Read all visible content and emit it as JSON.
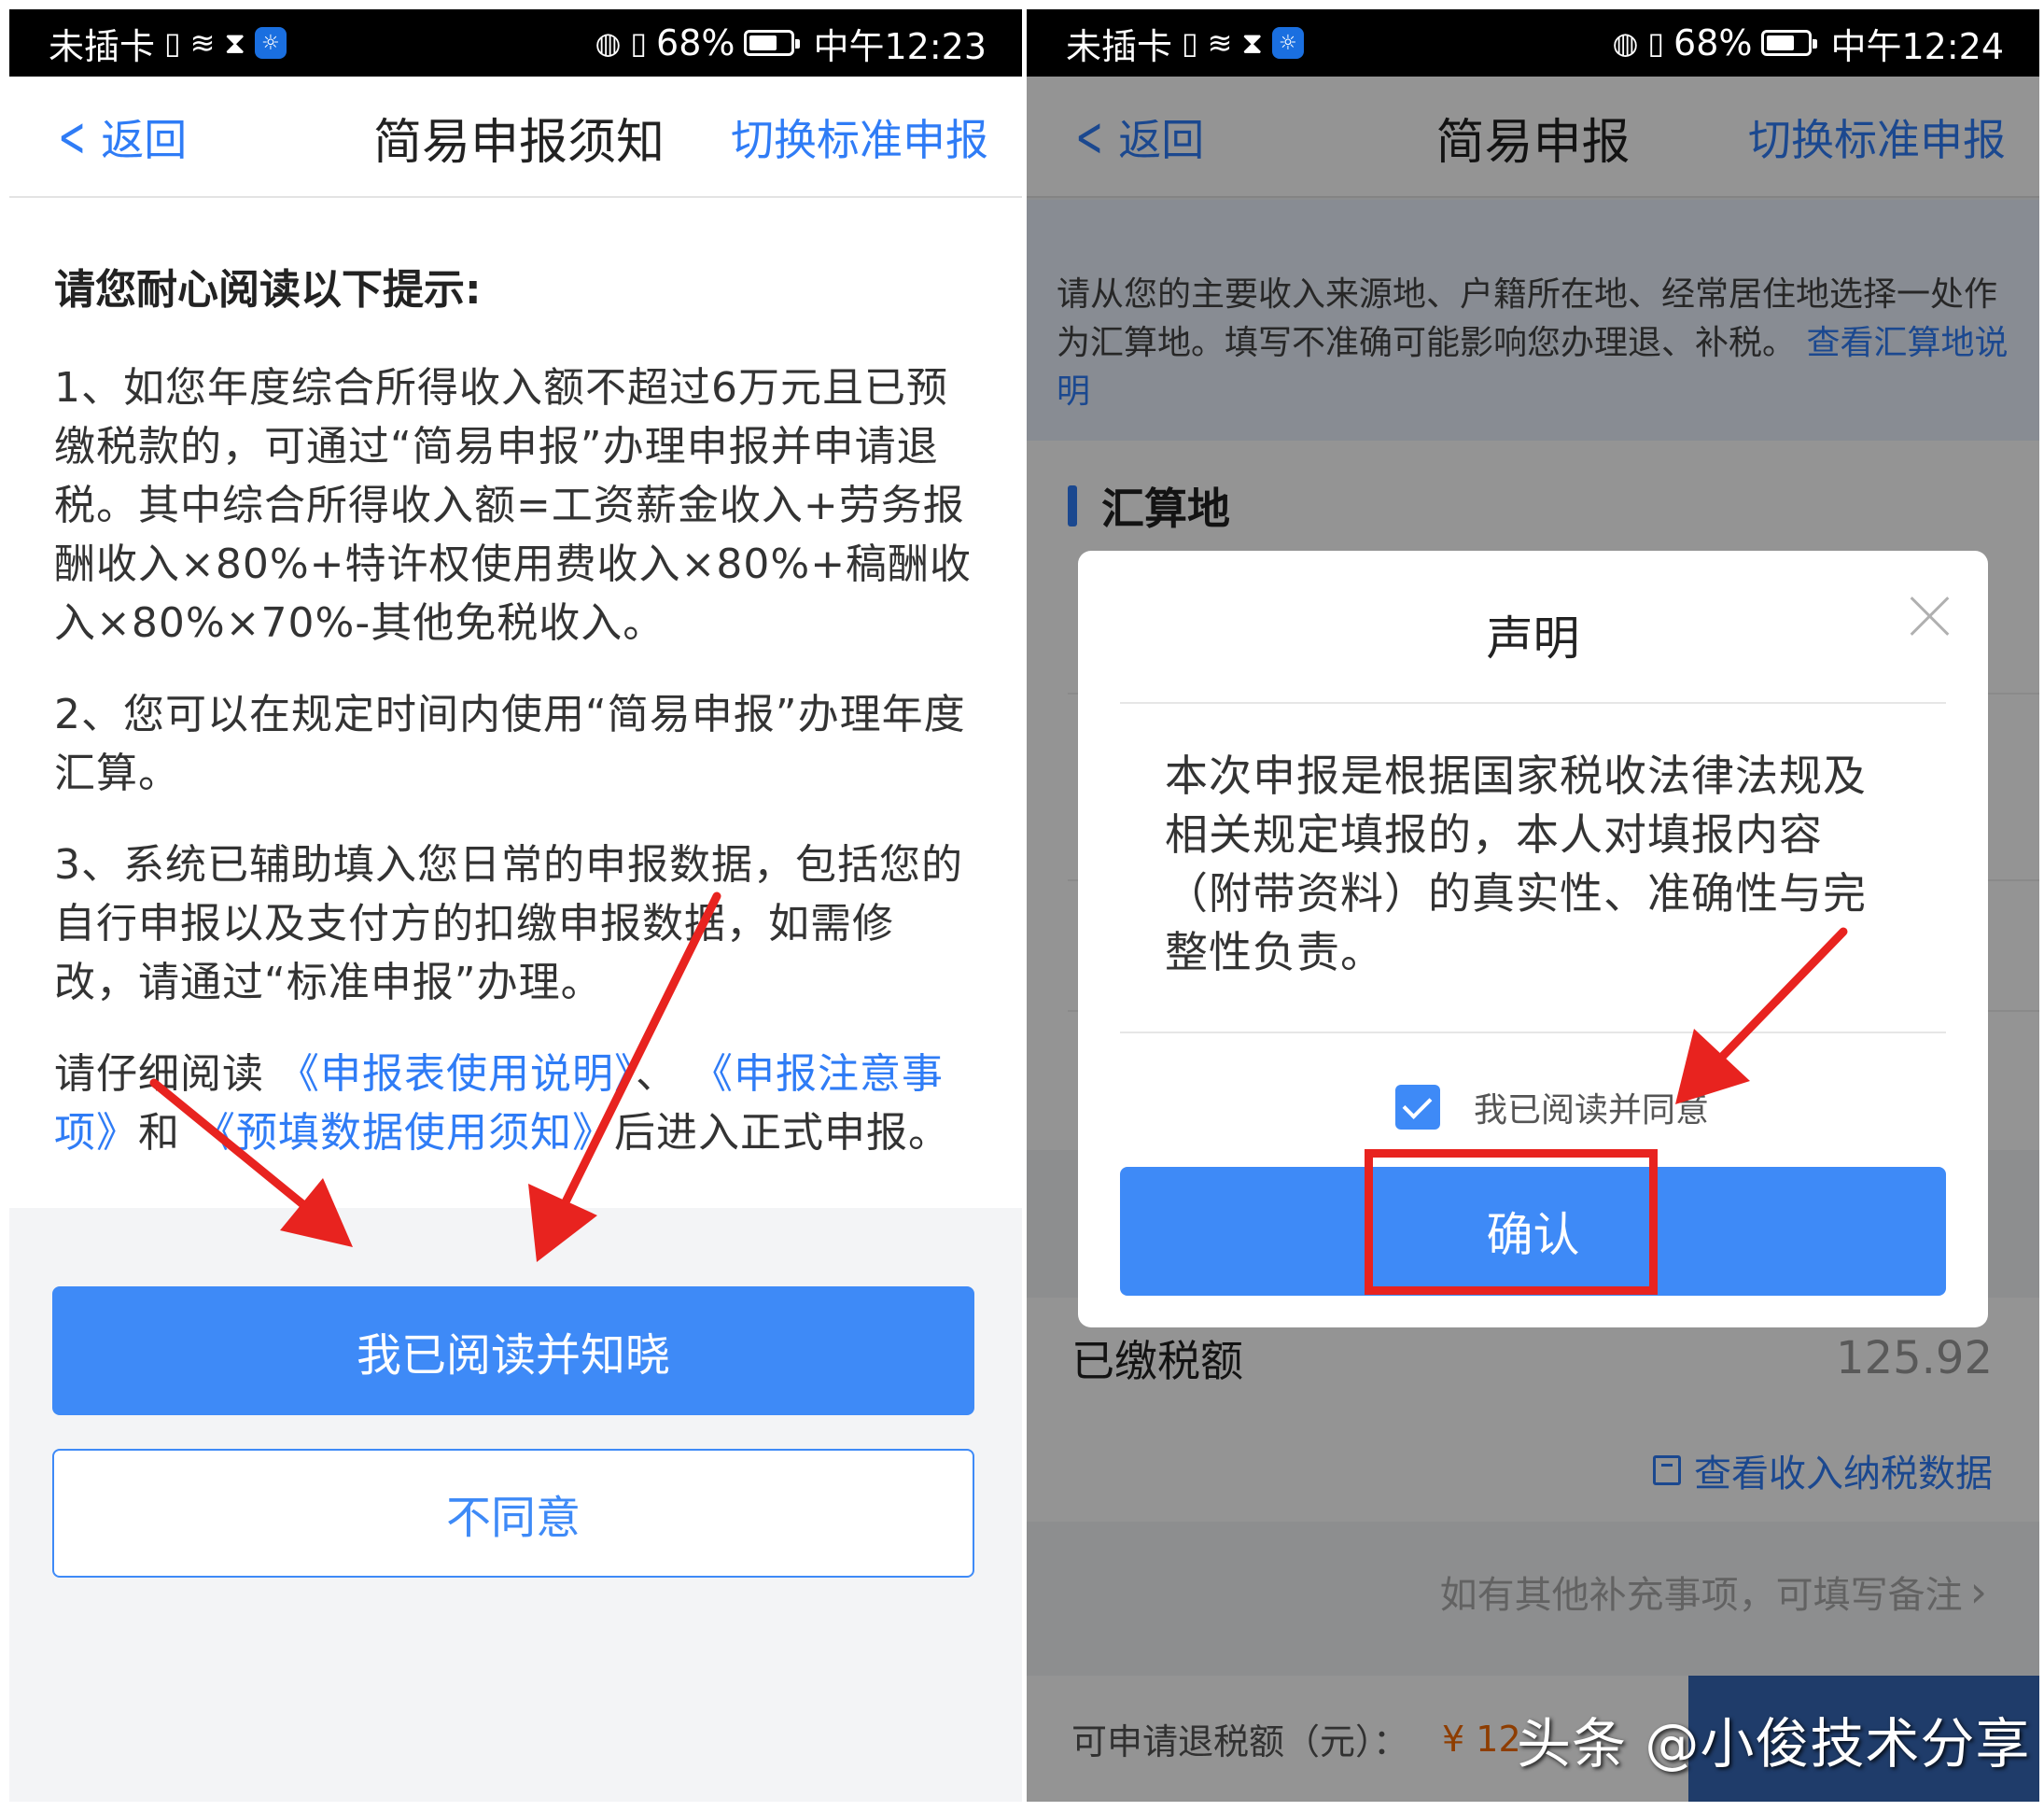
{
  "status_left": {
    "carrier": "未插卡",
    "time": "中午12:23",
    "battery": "68%"
  },
  "status_right": {
    "carrier": "未插卡",
    "time": "中午12:24",
    "battery": "68%"
  },
  "left_screen": {
    "nav": {
      "back": "返回",
      "title": "简易申报须知",
      "switch": "切换标准申报"
    },
    "heading": "请您耐心阅读以下提示:",
    "para1": "1、如您年度综合所得收入额不超过6万元且已预缴税款的，可通过“简易申报”办理申报并申请退税。其中综合所得收入额=工资薪金收入+劳务报酬收入×80%+特许权使用费收入×80%+稿酬收入×80%×70%-其他免税收入。",
    "para2": "2、您可以在规定时间内使用“简易申报”办理年度汇算。",
    "para3": "3、系统已辅助填入您日常的申报数据，包括您的自行申报以及支付方的扣缴申报数据，如需修改，请通过“标准申报”办理。",
    "para4": {
      "prefix": "请仔细阅读",
      "link1": "《申报表使用说明》",
      "sep": "、",
      "link2": "《申报注意事项》",
      "and": "和",
      "link3": "《预填数据使用须知》",
      "suffix": "后进入正式申报。"
    },
    "btn_acknowledge": "我已阅读并知晓",
    "btn_disagree": "不同意"
  },
  "right_screen": {
    "nav": {
      "back": "返回",
      "title": "简易申报",
      "switch": "切换标准申报"
    },
    "banner_text": "请从您的主要收入来源地、户籍所在地、经常居住地选择一处作为汇算地。填写不准确可能影响您办理退、补税。",
    "banner_link": "查看汇算地说明",
    "section_title": "汇算地",
    "paid_label": "已缴税额",
    "paid_value": "125.92",
    "view_data": "查看收入纳税数据",
    "remarks": "如有其他补充事项，可填写备注",
    "refund_label": "可申请退税额（元）：",
    "refund_value": "¥ 12",
    "dialog": {
      "title": "声明",
      "body": "本次申报是根据国家税收法律法规及相关规定填报的，本人对填报内容（附带资料）的真实性、准确性与完整性负责。",
      "checkbox_label": "我已阅读并同意",
      "confirm": "确认"
    }
  },
  "watermark": "头条 @小俊技术分享",
  "colors": {
    "accent": "#3e8af7",
    "link": "#2f7cf6",
    "annotation_red": "#e8231f",
    "refund_orange": "#f56a00"
  }
}
